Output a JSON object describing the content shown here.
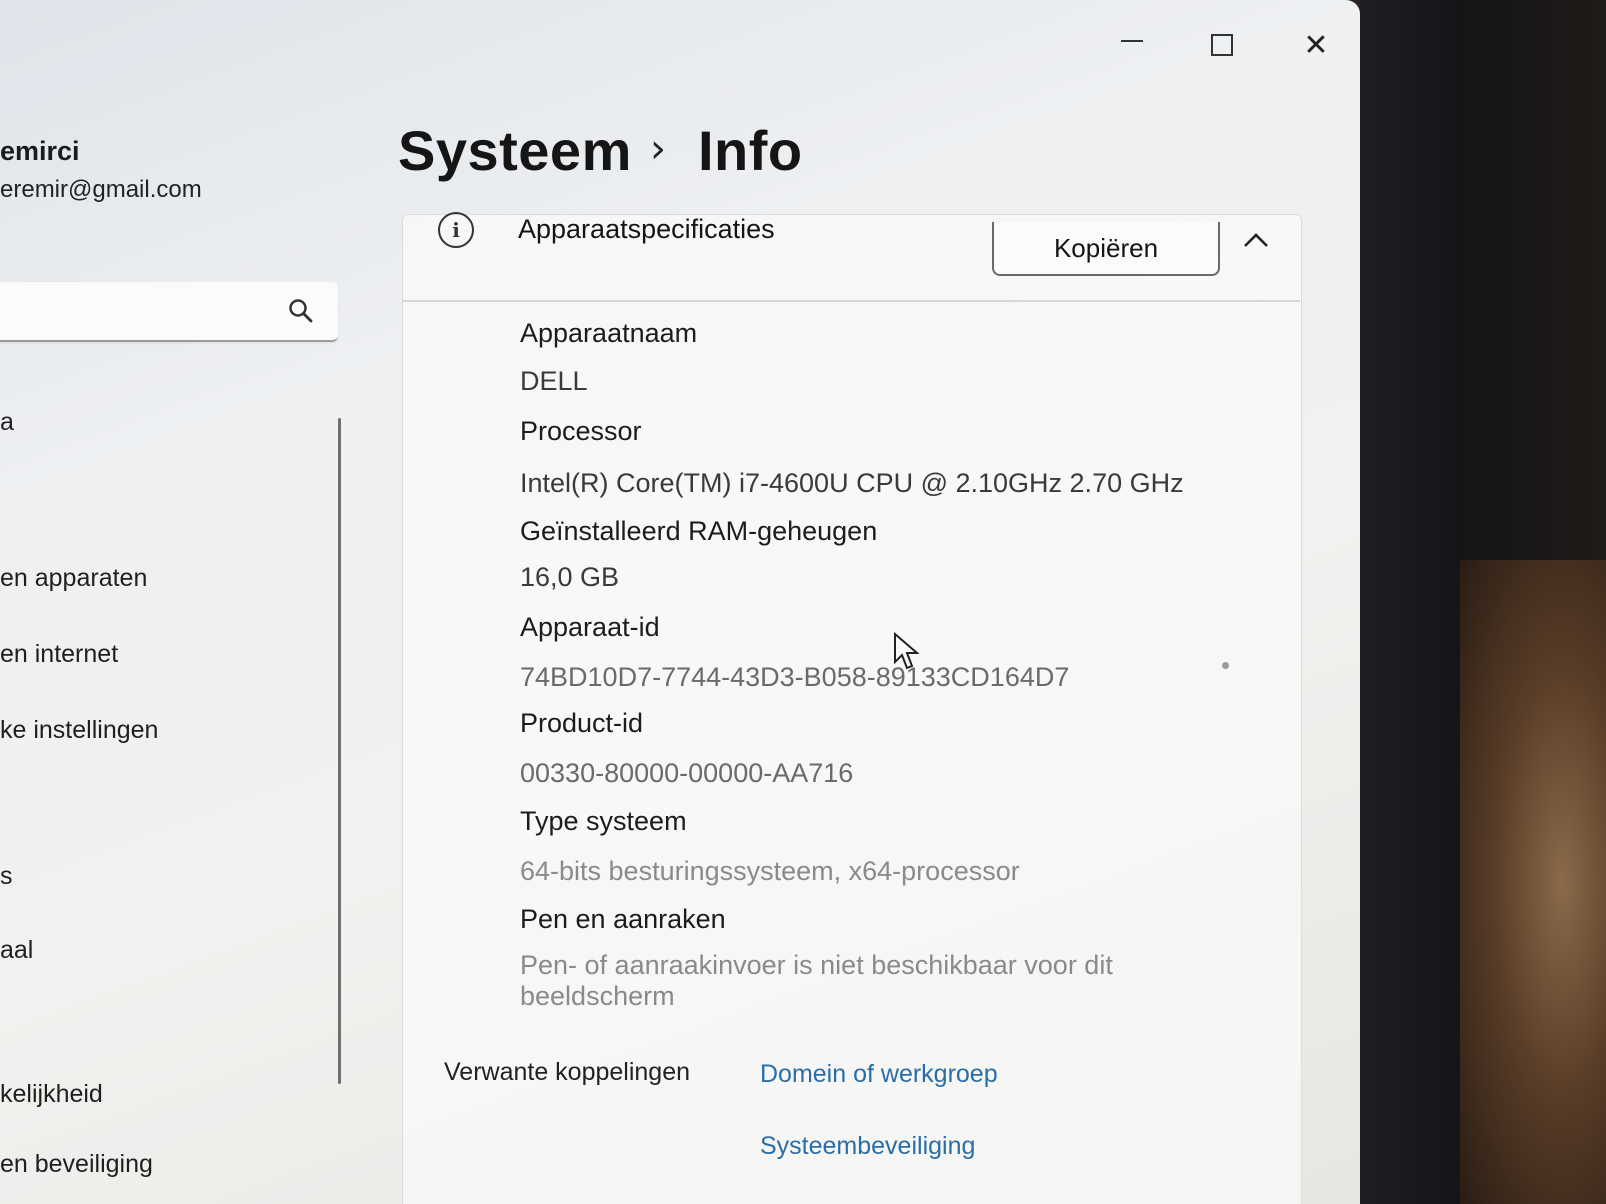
{
  "window": {
    "controls": {
      "minimize": "minimize-icon",
      "maximize": "maximize-icon",
      "close": "close-icon",
      "close_glyph": "✕"
    }
  },
  "account": {
    "name": "emirci",
    "email": "eremir@gmail.com"
  },
  "search": {
    "value": "",
    "icon": "search-icon"
  },
  "sidebar": {
    "items": [
      {
        "label": "a"
      },
      {
        "label": "en apparaten"
      },
      {
        "label": "en internet"
      },
      {
        "label": "ke instellingen"
      },
      {
        "label": "s"
      },
      {
        "label": "aal"
      },
      {
        "label": "kelijkheid"
      },
      {
        "label": "en beveiliging"
      }
    ]
  },
  "breadcrumb": {
    "parent": "Systeem",
    "separator": "›",
    "current": "Info"
  },
  "device_specs": {
    "title": "Apparaatspecificaties",
    "copy_label": "Kopiëren",
    "rows": [
      {
        "label": "Apparaatnaam",
        "value": "DELL"
      },
      {
        "label": "Processor",
        "value": "Intel(R) Core(TM) i7-4600U CPU @ 2.10GHz   2.70 GHz"
      },
      {
        "label": "Geïnstalleerd RAM-geheugen",
        "value": "16,0 GB"
      },
      {
        "label": "Apparaat-id",
        "value": "74BD10D7-7744-43D3-B058-89133CD164D7"
      },
      {
        "label": "Product-id",
        "value": "00330-80000-00000-AA716"
      },
      {
        "label": "Type systeem",
        "value": "64-bits besturingssysteem, x64-processor"
      },
      {
        "label": "Pen en aanraken",
        "value": "Pen- of aanraakinvoer is niet beschikbaar voor dit beeldscherm"
      }
    ]
  },
  "related": {
    "label": "Verwante koppelingen",
    "links": [
      {
        "label": "Domein of werkgroep"
      },
      {
        "label": "Systeembeveiliging"
      }
    ]
  },
  "colors": {
    "link": "#2a6ea8",
    "text": "#151515"
  }
}
